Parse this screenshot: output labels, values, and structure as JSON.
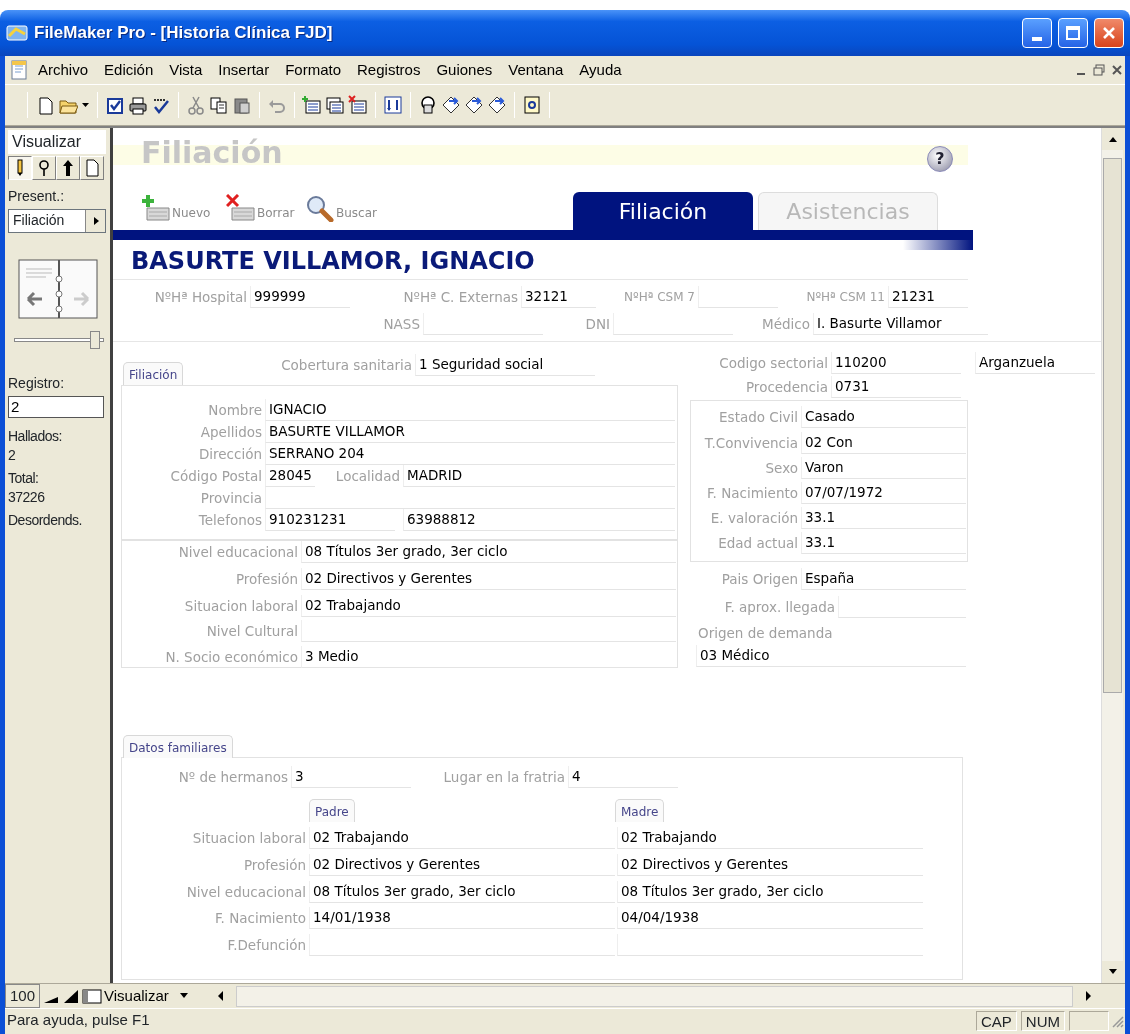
{
  "window": {
    "title": "FileMaker Pro - [Historia Clínica FJD]"
  },
  "menu": [
    {
      "label": "Archivo"
    },
    {
      "label": "Edición"
    },
    {
      "label": "Vista"
    },
    {
      "label": "Insertar"
    },
    {
      "label": "Formato"
    },
    {
      "label": "Registros"
    },
    {
      "label": "Guiones"
    },
    {
      "label": "Ventana"
    },
    {
      "label": "Ayuda"
    }
  ],
  "status_area": {
    "title": "Visualizar",
    "modes": [
      {
        "selected": true
      },
      {
        "selected": false
      },
      {
        "selected": false
      },
      {
        "selected": false
      }
    ],
    "layout_label": "Present.:",
    "layout_value": "Filiación",
    "slider": {
      "level": 0.95
    },
    "record_label": "Registro:",
    "record": "2",
    "found_label": "Hallados:",
    "found": "2",
    "total_label": "Total:",
    "total": "37226",
    "sort_state": "Desordends."
  },
  "layout": {
    "title": "Filiación",
    "help": "?",
    "buttons": [
      {
        "label": "Nuevo",
        "kind": "new"
      },
      {
        "label": "Borrar",
        "kind": "delete"
      },
      {
        "label": "Buscar",
        "kind": "find"
      }
    ],
    "tabs": [
      {
        "label": "Filiación",
        "selected": true
      },
      {
        "label": "Asistencias",
        "selected": false
      }
    ],
    "patient": "BASURTE VILLAMOR, IGNACIO",
    "section_tab": "Filiación",
    "fields": [
      {
        "label": "NºHª Hospital",
        "value": "999999"
      },
      {
        "label": "NºHª C. Externas",
        "value": "32121"
      },
      {
        "label": "NºHª CSM 7"
      },
      {
        "label": "NºHª CSM 11",
        "value": "21231"
      },
      {
        "label": "NASS"
      },
      {
        "label": "DNI"
      },
      {
        "label": "Médico",
        "value": "I. Basurte Villamor"
      },
      {
        "label": "Cobertura sanitaria",
        "value": "1 Seguridad social"
      },
      {
        "label": "Codigo sectorial",
        "value": "110200"
      },
      {
        "value": "Arganzuela"
      },
      {
        "label": "Procedencia",
        "value": "0731"
      },
      {
        "label": "Nombre",
        "value": "IGNACIO"
      },
      {
        "label": "Apellidos",
        "value": "BASURTE VILLAMOR"
      },
      {
        "label": "Dirección",
        "value": "SERRANO 204"
      },
      {
        "label": "Código Postal",
        "value": "28045"
      },
      {
        "label": "Localidad",
        "value": "MADRID"
      },
      {
        "label": "Provincia"
      },
      {
        "label": "Telefonos",
        "value": "910231231"
      },
      {
        "value": "63988812"
      },
      {
        "label": "Estado Civil",
        "value": "Casado"
      },
      {
        "label": "T.Convivencia",
        "value": "02 Con"
      },
      {
        "label": "Sexo",
        "value": "Varon"
      },
      {
        "label": "F. Nacimiento",
        "value": "07/07/1972"
      },
      {
        "label": "E. valoración",
        "value": "33.1"
      },
      {
        "label": "Edad actual",
        "value": "33.1"
      },
      {
        "label": "Nivel educacional",
        "value": "08 Títulos 3er grado, 3er ciclo"
      },
      {
        "label": "Profesión",
        "value": "02 Directivos y Gerentes"
      },
      {
        "label": "Situacion laboral",
        "value": "02 Trabajando"
      },
      {
        "label": "Nivel Cultural"
      },
      {
        "label": "N. Socio económico",
        "value": "3 Medio"
      },
      {
        "label": "Pais Origen",
        "value": "España"
      },
      {
        "label": "F. aprox. llegada"
      },
      {
        "label": "Origen de demanda",
        "value": "03 Médico",
        "kind": "stacked"
      },
      {
        "label": "Nº de hermanos",
        "value": "3"
      },
      {
        "label": "Lugar en la fratria",
        "value": "4"
      }
    ],
    "family": {
      "tab": "Datos familiares",
      "parents": [
        "Padre",
        "Madre"
      ],
      "rows": [
        {
          "label": "Situacion laboral",
          "father": "02 Trabajando",
          "mother": "02 Trabajando"
        },
        {
          "label": "Profesión",
          "father": "02 Directivos y Gerentes",
          "mother": "02 Directivos y Gerentes"
        },
        {
          "label": "Nivel educacional",
          "father": "08 Títulos 3er grado, 3er ciclo",
          "mother": "08 Títulos 3er grado, 3er ciclo"
        },
        {
          "label": "F. Nacimiento",
          "father": "14/01/1938",
          "mother": "04/04/1938"
        },
        {
          "label": "F.Defunción"
        }
      ]
    }
  },
  "bottom_bar": {
    "zoom": "100",
    "mode_menu": "Visualizar"
  },
  "status_bar": {
    "help_text": "Para ayuda, pulse F1",
    "indicators": [
      "CAP",
      "NUM"
    ]
  }
}
